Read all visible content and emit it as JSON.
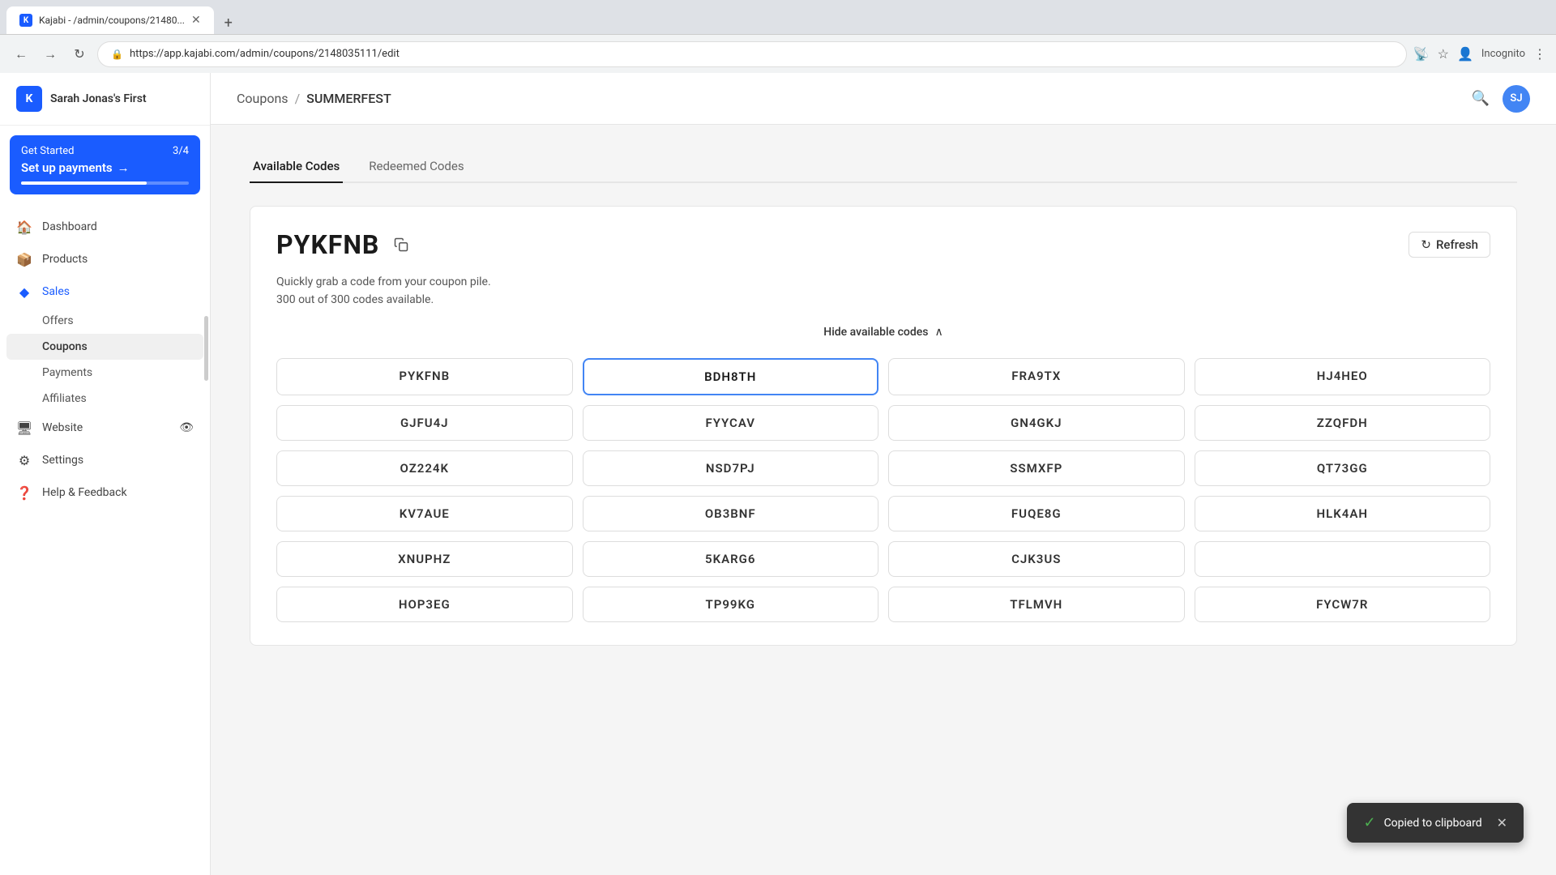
{
  "browser": {
    "tab_title": "Kajabi - /admin/coupons/21480...",
    "tab_favicon": "K",
    "url": "app.kajabi.com/admin/coupons/2148035111/edit",
    "url_full": "https://app.kajabi.com/admin/coupons/2148035111/edit"
  },
  "sidebar": {
    "logo_text": "K",
    "brand_name": "Sarah Jonas's First",
    "get_started": {
      "label": "Get Started",
      "progress_label": "3/4",
      "cta": "Set up payments",
      "arrow": "→"
    },
    "nav_items": [
      {
        "id": "dashboard",
        "label": "Dashboard",
        "icon": "🏠"
      },
      {
        "id": "products",
        "label": "Products",
        "icon": "📦"
      },
      {
        "id": "sales",
        "label": "Sales",
        "icon": "◆"
      },
      {
        "id": "website",
        "label": "Website",
        "icon": "🖥"
      },
      {
        "id": "settings",
        "label": "Settings",
        "icon": "⚙"
      },
      {
        "id": "help",
        "label": "Help & Feedback",
        "icon": "❓"
      }
    ],
    "sales_sub_items": [
      {
        "id": "offers",
        "label": "Offers"
      },
      {
        "id": "coupons",
        "label": "Coupons",
        "active": true
      },
      {
        "id": "payments",
        "label": "Payments"
      },
      {
        "id": "affiliates",
        "label": "Affiliates"
      }
    ]
  },
  "topbar": {
    "breadcrumb_parent": "Coupons",
    "breadcrumb_sep": "/",
    "breadcrumb_current": "SUMMERFEST",
    "avatar_text": "SJ"
  },
  "tabs": [
    {
      "id": "available",
      "label": "Available Codes",
      "active": true
    },
    {
      "id": "redeemed",
      "label": "Redeemed Codes",
      "active": false
    }
  ],
  "code_panel": {
    "main_code": "PYKFNB",
    "refresh_label": "Refresh",
    "description_line1": "Quickly grab a code from your coupon pile.",
    "description_line2": "300 out of 300 codes available.",
    "hide_label": "Hide available codes",
    "codes": [
      "PYKFNB",
      "BDH8TH",
      "FRA9TX",
      "HJ4HEO",
      "GJFU4J",
      "FYYCAV",
      "GN4GKJ",
      "ZZQFDH",
      "OZ224K",
      "NSD7PJ",
      "SSMXFP",
      "QT73GG",
      "KV7AUE",
      "OB3BNF",
      "FUQE8G",
      "HLK4AH",
      "XNUPHZ",
      "5KARG6",
      "CJK3US",
      "",
      "HOP3EG",
      "TP99KG",
      "TFLMVH",
      "FYCW7R"
    ],
    "selected_code": "BDH8TH"
  },
  "toast": {
    "message": "Copied to clipboard",
    "check_icon": "✓"
  }
}
